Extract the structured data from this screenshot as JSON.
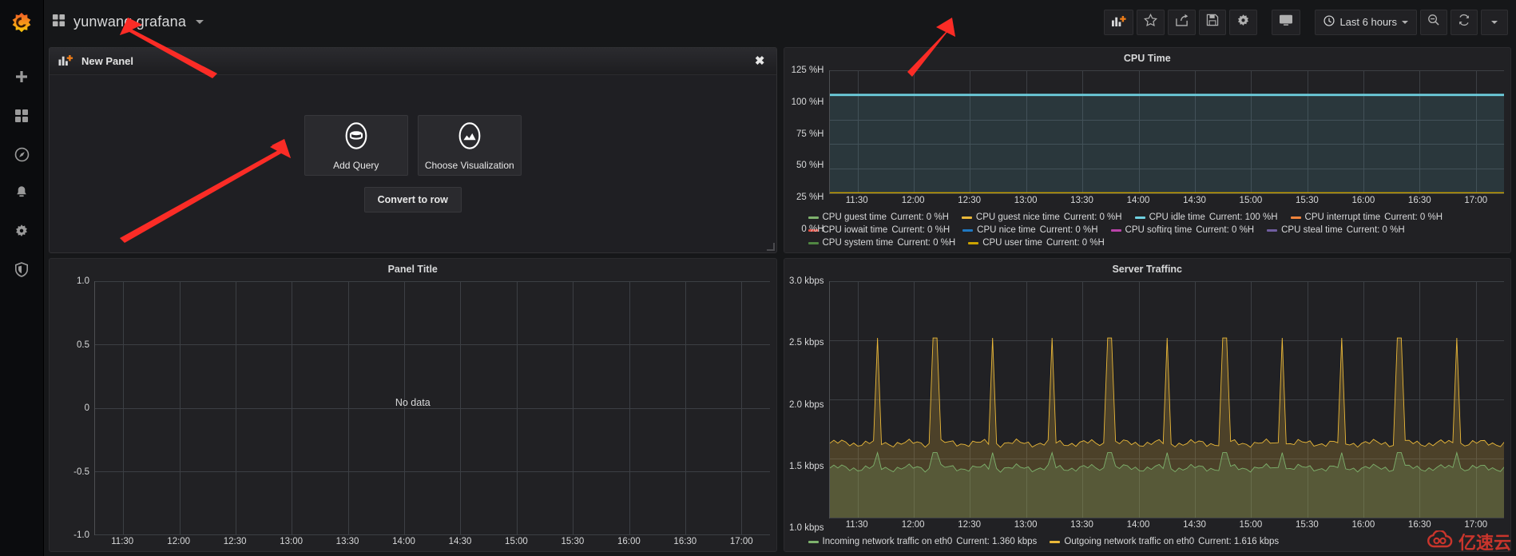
{
  "app": {
    "logo": "grafana-logo",
    "dashboard_title": "yunwang grafana"
  },
  "sidebar": {
    "items": [
      {
        "name": "create",
        "icon": "plus-icon"
      },
      {
        "name": "dashboards",
        "icon": "grid-icon"
      },
      {
        "name": "explore",
        "icon": "compass-icon"
      },
      {
        "name": "alerting",
        "icon": "bell-icon"
      },
      {
        "name": "configuration",
        "icon": "gear-icon"
      },
      {
        "name": "server-admin",
        "icon": "shield-icon"
      }
    ]
  },
  "toolbar": {
    "add_panel": "add-panel-icon",
    "star": "star-icon",
    "share": "share-icon",
    "save": "save-icon",
    "settings": "gear-icon",
    "cycle_view": "tv-icon",
    "time_range": "Last 6 hours",
    "time_icon": "clock-icon",
    "zoom_out": "zoom-out-icon",
    "refresh": "refresh-icon",
    "refresh_dropdown": "chevron-down-icon"
  },
  "new_panel": {
    "title": "New Panel",
    "icon": "add-panel-icon",
    "close": "✖",
    "add_query": "Add Query",
    "add_query_icon": "database-icon",
    "choose_visualization": "Choose Visualization",
    "choose_visualization_icon": "graph-icon",
    "convert_to_row": "Convert to row"
  },
  "panels": {
    "cpu_time": {
      "title": "CPU Time"
    },
    "panel_title": {
      "title": "Panel Title",
      "no_data": "No data"
    },
    "server_traffic": {
      "title": "Server Traffinc"
    }
  },
  "watermark": {
    "text": "亿速云"
  },
  "chart_data": [
    {
      "id": "cpu_time",
      "type": "line",
      "title": "CPU Time",
      "xlabel": "",
      "ylabel": "",
      "ylim": [
        0,
        125
      ],
      "yticks": [
        "0 %H",
        "25 %H",
        "50 %H",
        "75 %H",
        "100 %H",
        "125 %H"
      ],
      "ytick_values": [
        0,
        25,
        50,
        75,
        100,
        125
      ],
      "xticks": [
        "11:30",
        "12:00",
        "12:30",
        "13:00",
        "13:30",
        "14:00",
        "14:30",
        "15:00",
        "15:30",
        "16:00",
        "16:30",
        "17:00"
      ],
      "grid": true,
      "legend_position": "bottom",
      "series": [
        {
          "name": "CPU guest time",
          "current_label": "Current: 0 %H",
          "current": 0,
          "color": "#7eb26d",
          "constant": 0
        },
        {
          "name": "CPU guest nice time",
          "current_label": "Current: 0 %H",
          "current": 0,
          "color": "#eab839",
          "constant": 0
        },
        {
          "name": "CPU idle time",
          "current_label": "Current: 100 %H",
          "current": 100,
          "color": "#6ed0e0",
          "constant": 100
        },
        {
          "name": "CPU interrupt time",
          "current_label": "Current: 0 %H",
          "current": 0,
          "color": "#ef843c",
          "constant": 0
        },
        {
          "name": "CPU iowait time",
          "current_label": "Current: 0 %H",
          "current": 0,
          "color": "#e24d42",
          "constant": 0
        },
        {
          "name": "CPU nice time",
          "current_label": "Current: 0 %H",
          "current": 0,
          "color": "#1f78c1",
          "constant": 0
        },
        {
          "name": "CPU softirq time",
          "current_label": "Current: 0 %H",
          "current": 0,
          "color": "#ba43a9",
          "constant": 0
        },
        {
          "name": "CPU steal time",
          "current_label": "Current: 0 %H",
          "current": 0,
          "color": "#705da0",
          "constant": 0
        },
        {
          "name": "CPU system time",
          "current_label": "Current: 0 %H",
          "current": 0,
          "color": "#508642",
          "constant": 0
        },
        {
          "name": "CPU user time",
          "current_label": "Current: 0 %H",
          "current": 0,
          "color": "#cca300",
          "constant": 0
        }
      ]
    },
    {
      "id": "panel_title",
      "type": "line",
      "title": "Panel Title",
      "xlabel": "",
      "ylabel": "",
      "ylim": [
        -1.0,
        1.0
      ],
      "yticks": [
        "-1.0",
        "-0.5",
        "0",
        "0.5",
        "1.0"
      ],
      "ytick_values": [
        -1.0,
        -0.5,
        0,
        0.5,
        1.0
      ],
      "xticks": [
        "11:30",
        "12:00",
        "12:30",
        "13:00",
        "13:30",
        "14:00",
        "14:30",
        "15:00",
        "15:30",
        "16:00",
        "16:30",
        "17:00"
      ],
      "grid": true,
      "series": [],
      "empty_message": "No data"
    },
    {
      "id": "server_traffic",
      "type": "line",
      "title": "Server Traffinc",
      "xlabel": "",
      "ylabel": "",
      "ylim": [
        1.0,
        3.0
      ],
      "yticks": [
        "1.0 kbps",
        "1.5 kbps",
        "2.0 kbps",
        "2.5 kbps",
        "3.0 kbps"
      ],
      "ytick_values": [
        1.0,
        1.5,
        2.0,
        2.5,
        3.0
      ],
      "xticks": [
        "11:30",
        "12:00",
        "12:30",
        "13:00",
        "13:30",
        "14:00",
        "14:30",
        "15:00",
        "15:30",
        "16:00",
        "16:30",
        "17:00"
      ],
      "grid": true,
      "legend_position": "bottom",
      "series": [
        {
          "name": "Incoming network traffic on eth0",
          "current_label": "Current: 1.360 kbps",
          "current": 1.36,
          "color": "#7eb26d",
          "baseline": 1.42,
          "spike_peak": 1.55
        },
        {
          "name": "Outgoing network traffic on eth0",
          "current_label": "Current: 1.616 kbps",
          "current": 1.616,
          "color": "#eab839",
          "baseline": 1.63,
          "spike_peak": 2.52
        }
      ],
      "spike_times": [
        "11:52",
        "12:22",
        "12:52",
        "13:22",
        "13:52",
        "14:22",
        "14:52",
        "15:22",
        "15:52",
        "16:22",
        "16:52"
      ]
    }
  ]
}
